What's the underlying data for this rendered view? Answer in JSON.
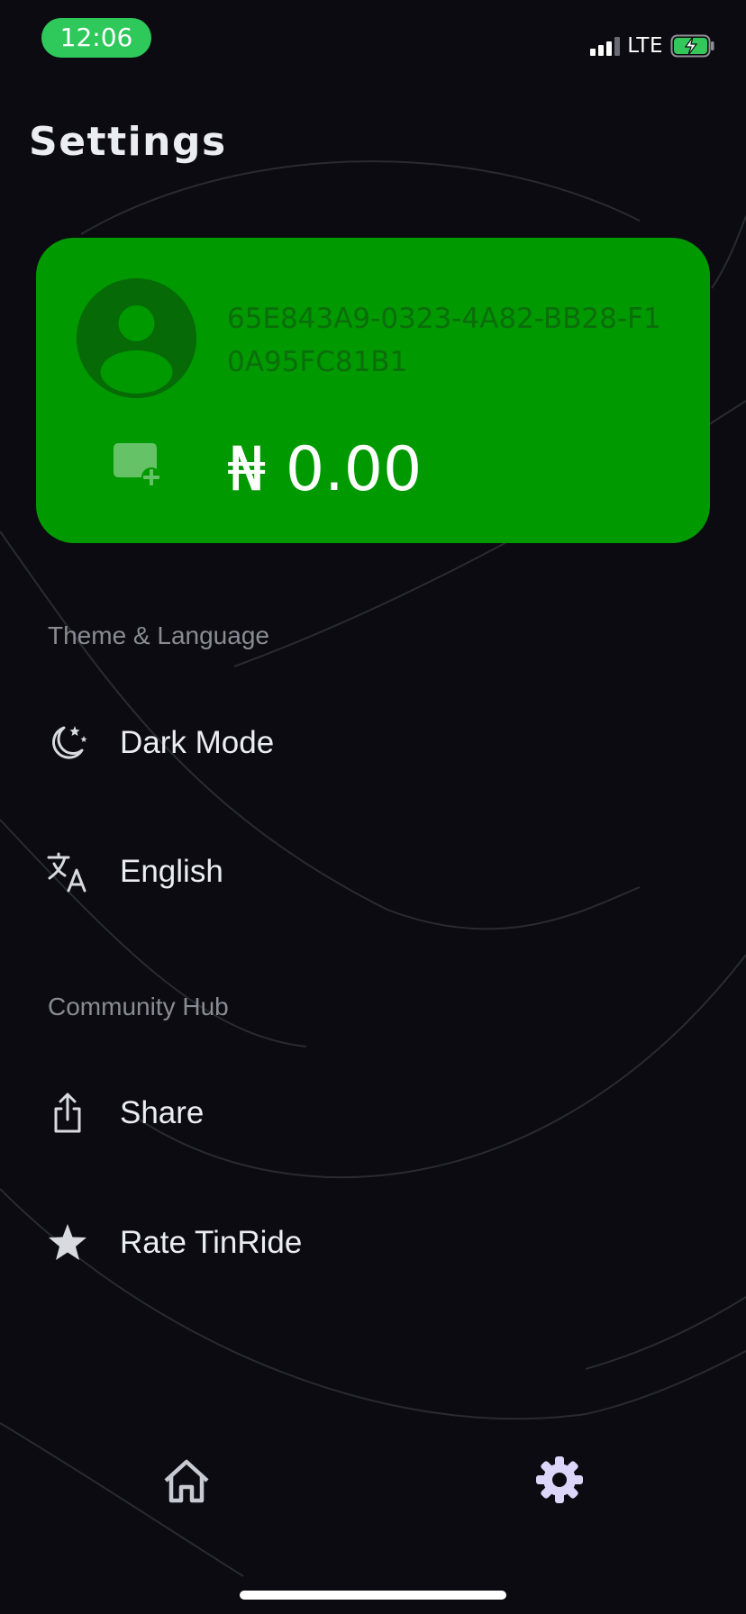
{
  "status_bar": {
    "time": "12:06",
    "network": "LTE",
    "icons": [
      "signal-icon",
      "battery-charging-icon"
    ]
  },
  "header": {
    "title": "Settings"
  },
  "account_card": {
    "device_id": "65E843A9-0323-4A82-BB28-F10A95FC81B1",
    "balance": "₦ 0.00",
    "icons": [
      "user-avatar-icon",
      "add-card-icon"
    ],
    "colors": {
      "card": "#009900",
      "avatar": "#066a06",
      "id_text": "#0b6d0b"
    }
  },
  "sections": {
    "theme_language": {
      "label": "Theme & Language",
      "items": [
        {
          "label": "Dark Mode",
          "icon": "moon-stars-icon"
        },
        {
          "label": "English",
          "icon": "translate-icon"
        }
      ]
    },
    "community": {
      "label": "Community Hub",
      "items": [
        {
          "label": "Share",
          "icon": "share-icon"
        },
        {
          "label": "Rate TinRide",
          "icon": "star-icon"
        }
      ]
    }
  },
  "tab_bar": {
    "tabs": [
      {
        "name": "home",
        "icon": "home-icon",
        "active": false
      },
      {
        "name": "settings",
        "icon": "gear-icon",
        "active": true
      }
    ]
  },
  "theme": {
    "background": "#0b0b11",
    "status_pill": "#2fc95b",
    "active_tab": "#ddd6fb"
  }
}
